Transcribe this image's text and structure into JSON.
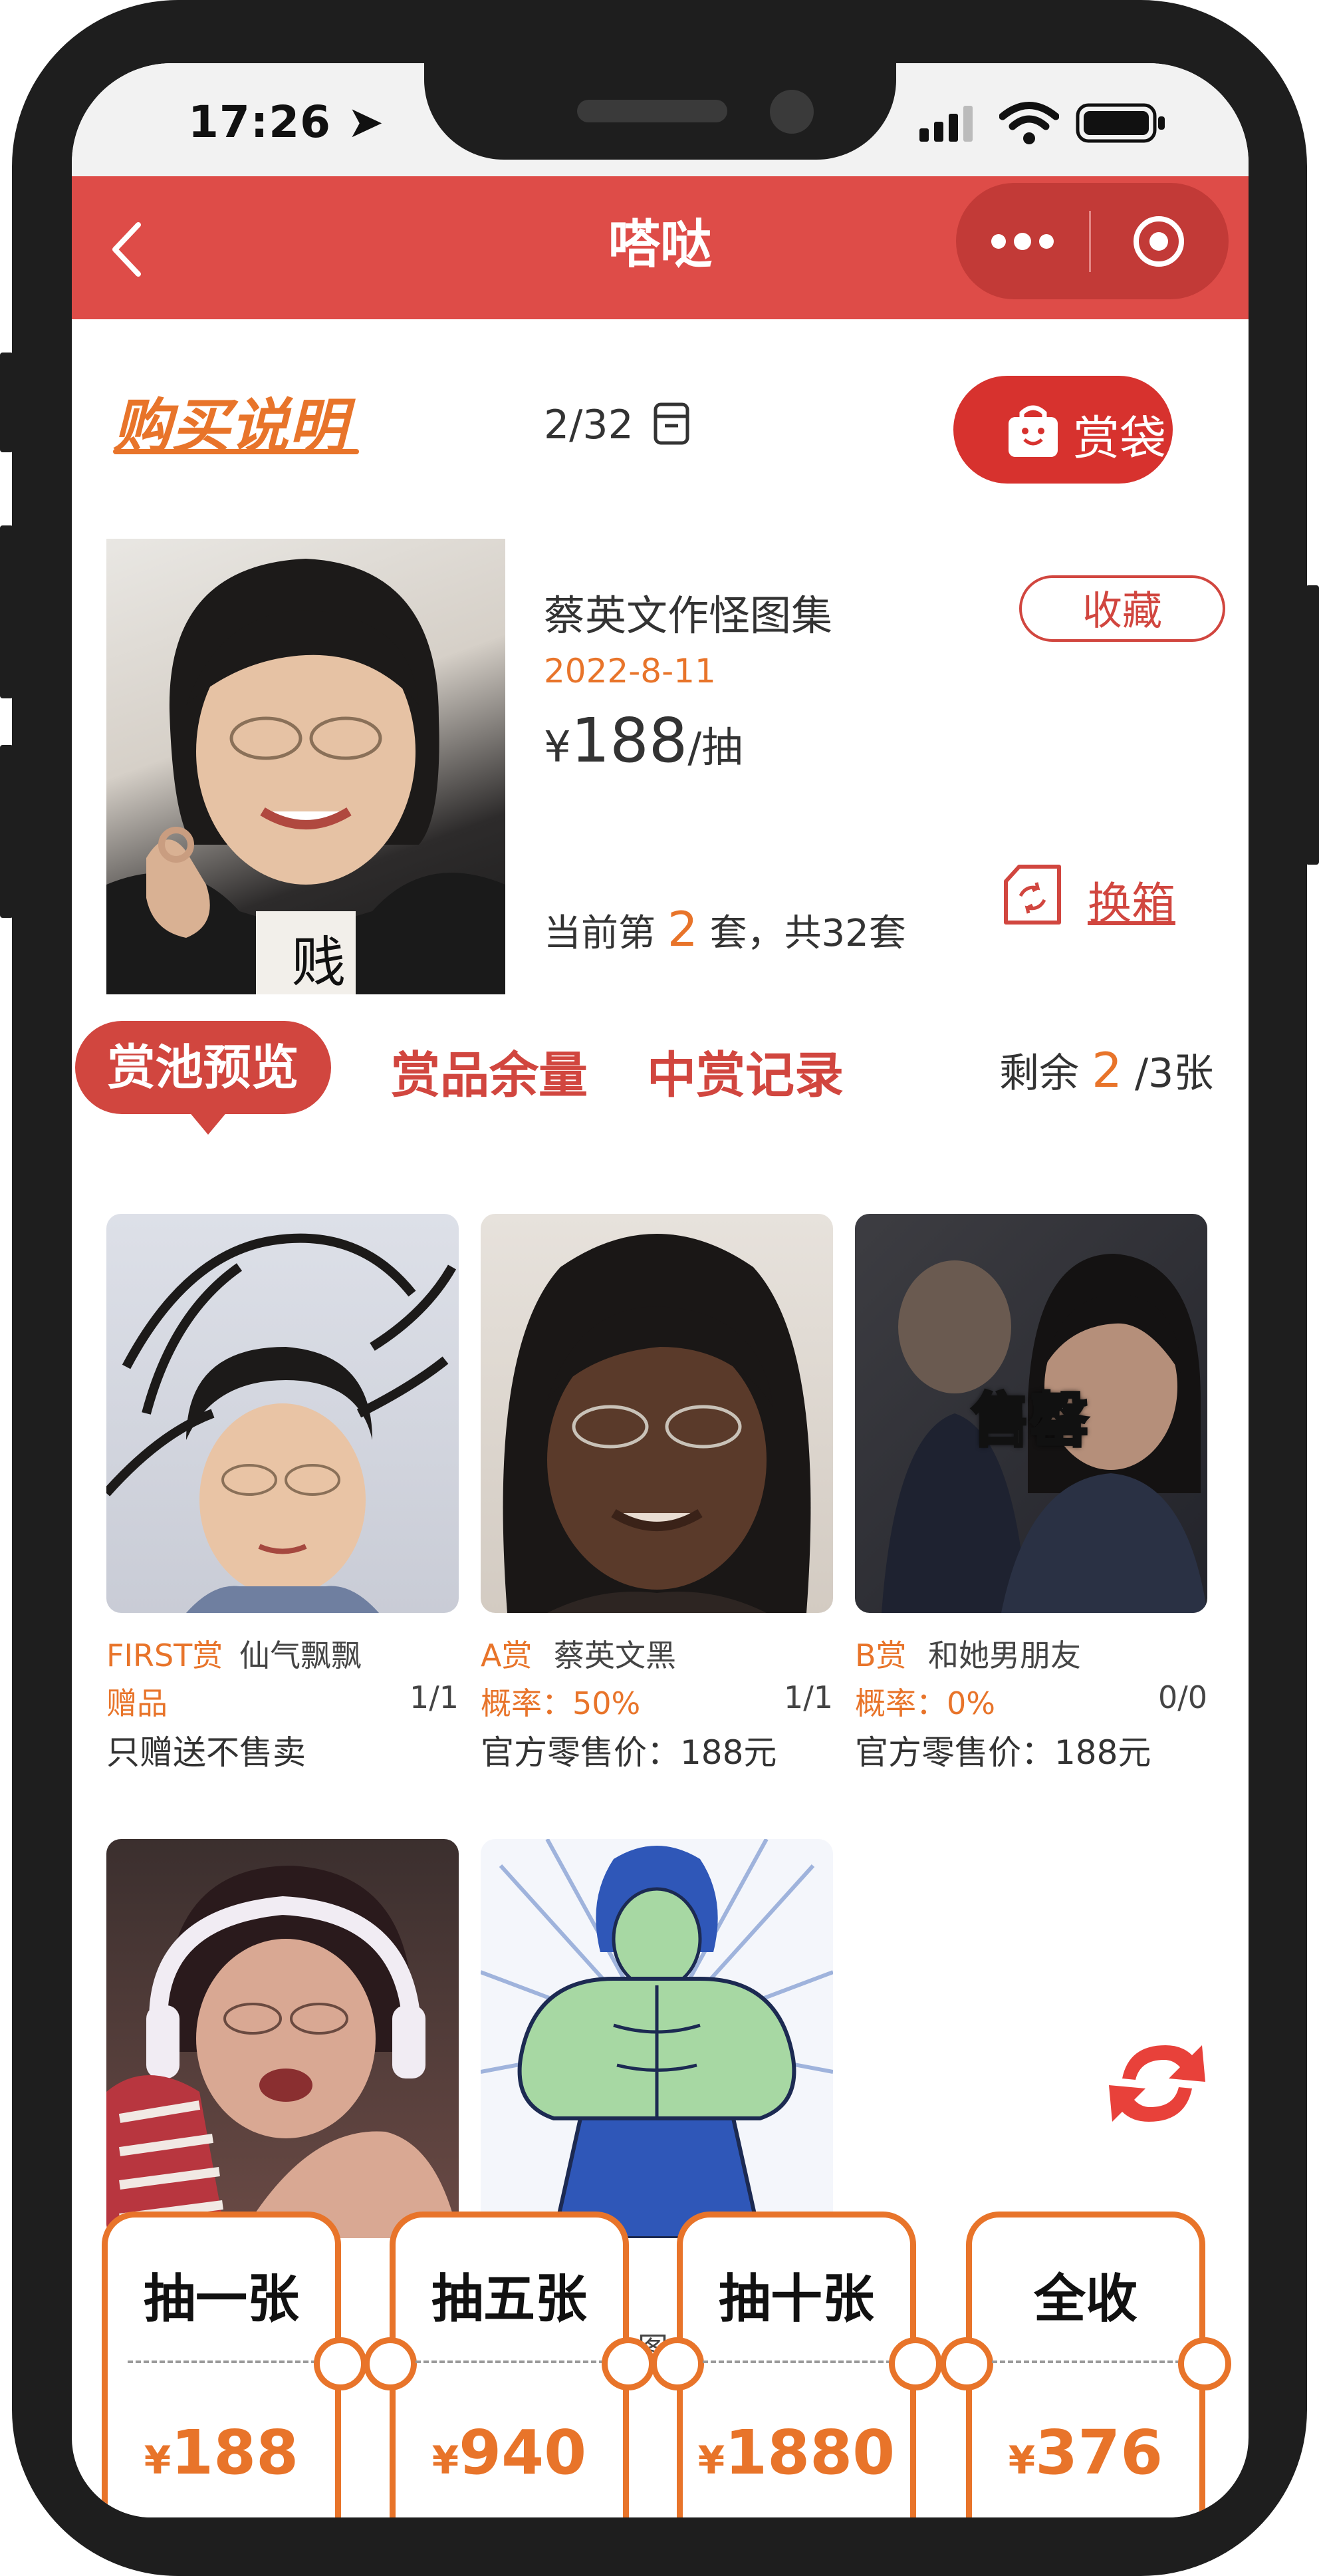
{
  "status_bar": {
    "time": "17:26"
  },
  "nav": {
    "title": "嗒哒"
  },
  "header": {
    "buy_instructions": "购买说明",
    "counter": "2/32",
    "bag_label": "赏袋"
  },
  "product": {
    "image_caption": "贱",
    "name": "蔡英文作怪图集",
    "date": "2022-8-11",
    "price_symbol": "¥",
    "price": "188",
    "price_unit": "/抽",
    "collect_label": "收藏",
    "set_prefix": "当前第",
    "set_current": "2",
    "set_suffix": "套，共32套",
    "switch_box_label": "换箱"
  },
  "tabs": {
    "pool_preview": "赏池预览",
    "prize_remaining": "赏品余量",
    "win_records": "中赏记录",
    "remain_prefix": "剩余",
    "remain_count": "2",
    "remain_suffix": "/3张"
  },
  "prizes": [
    {
      "tier": "FIRST赏",
      "name": "仙气飘飘",
      "type_label": "赠品",
      "count": "1/1",
      "footer": "只赠送不售卖",
      "overlay": ""
    },
    {
      "tier": "A赏",
      "name": "蔡英文黑",
      "type_label": "概率：50%",
      "count": "1/1",
      "footer": "官方零售价：188元",
      "overlay": ""
    },
    {
      "tier": "B赏",
      "name": "和她男朋友",
      "type_label": "概率：0%",
      "count": "0/0",
      "footer": "官方零售价：188元",
      "overlay": "售罄"
    },
    {
      "tier": "",
      "name": "",
      "type_label": "",
      "count": "",
      "footer": "",
      "overlay": ""
    },
    {
      "tier": "",
      "name": "色图",
      "type_label": "",
      "count": "",
      "footer": "",
      "overlay": ""
    }
  ],
  "draw_buttons": [
    {
      "label": "抽一张",
      "price": "188"
    },
    {
      "label": "抽五张",
      "price": "940"
    },
    {
      "label": "抽十张",
      "price": "1880"
    },
    {
      "label": "全收",
      "price": "376"
    }
  ],
  "currency_symbol": "¥",
  "colors": {
    "nav_red": "#de4c48",
    "accent_red": "#d1463f",
    "accent_orange": "#e8742a"
  }
}
